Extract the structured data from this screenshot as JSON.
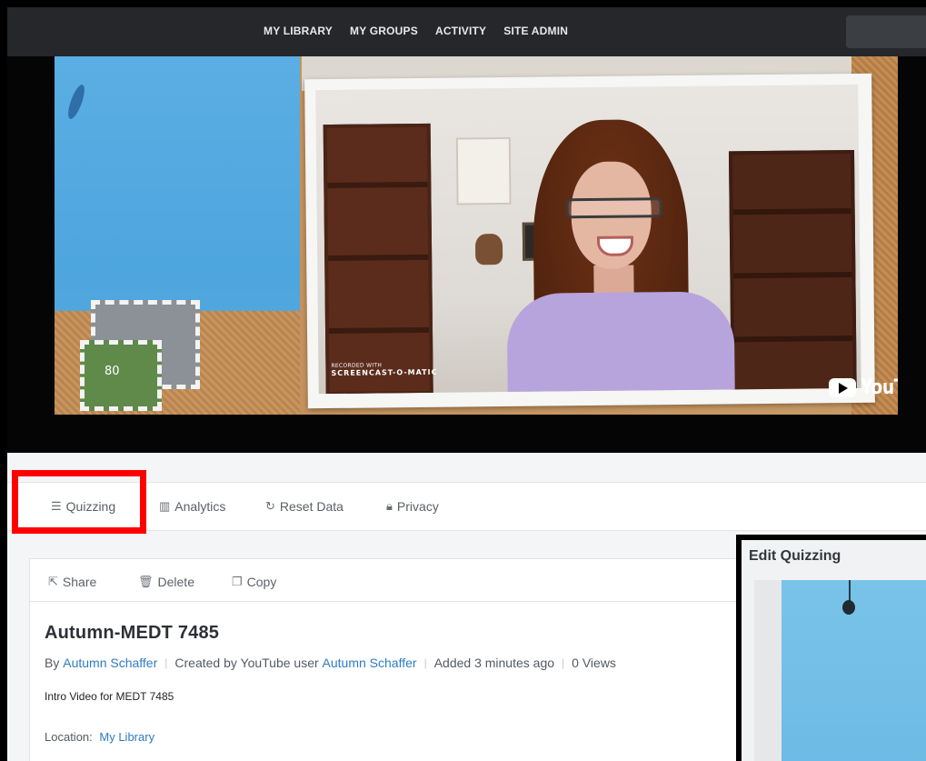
{
  "nav": {
    "items": [
      "MY LIBRARY",
      "MY GROUPS",
      "ACTIVITY",
      "SITE ADMIN"
    ]
  },
  "video": {
    "stamp_text": "80",
    "recorded_with": "RECORDED WITH",
    "screencast_brand": "SCREENCAST-O-MATIC",
    "youtube_logo": "YouTube"
  },
  "tabs": [
    {
      "icon": "quiz-list-icon",
      "glyph": "☰",
      "label": "Quizzing"
    },
    {
      "icon": "bar-chart-icon",
      "glyph": "▥",
      "label": "Analytics"
    },
    {
      "icon": "reset-icon",
      "glyph": "↻",
      "label": "Reset Data"
    },
    {
      "icon": "lock-icon",
      "glyph": "🔒︎",
      "label": "Privacy"
    }
  ],
  "actions": [
    {
      "icon": "share-icon",
      "glyph": "⇱",
      "label": "Share"
    },
    {
      "icon": "trash-icon",
      "glyph": "🗑︎",
      "label": "Delete"
    },
    {
      "icon": "copy-icon",
      "glyph": "❐",
      "label": "Copy"
    }
  ],
  "media": {
    "title": "Autumn-MEDT 7485",
    "by_prefix": "By",
    "author": "Autumn Schaffer",
    "created_prefix": "Created by YouTube user",
    "youtube_user": "Autumn Schaffer",
    "added": "Added 3 minutes ago",
    "views": "0 Views",
    "description": "Intro Video for MEDT 7485",
    "location_label": "Location:",
    "location_value": "My Library"
  },
  "inset": {
    "title": "Edit Quizzing"
  },
  "colors": {
    "nav_bg": "#25272b",
    "link": "#2f7bc1",
    "highlight": "#ff0000"
  }
}
